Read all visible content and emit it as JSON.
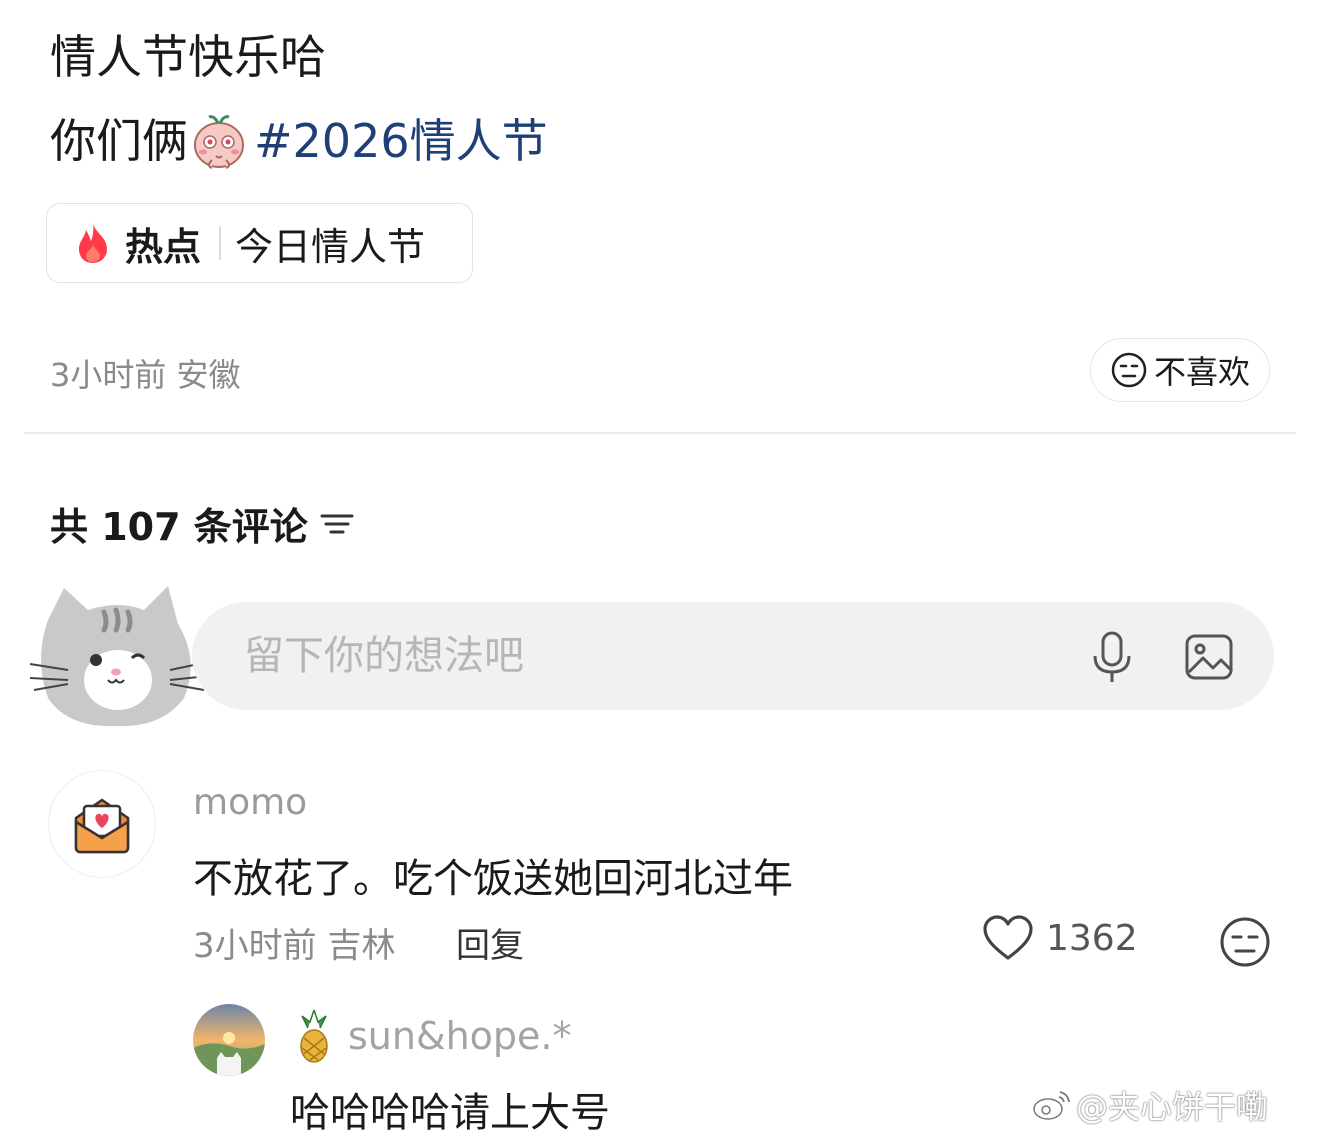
{
  "post": {
    "line1": "情人节快乐哈",
    "line2_prefix": "你们俩",
    "emoji": "shy-baby-emoji",
    "hashtag": "#2026情人节"
  },
  "hot_topic": {
    "label": "热点",
    "topic": "今日情人节",
    "icon": "fire-icon"
  },
  "post_meta": {
    "time": "3小时前",
    "location": "安徽"
  },
  "dislike_label": "不喜欢",
  "comments": {
    "title": "共 107 条评论",
    "input_placeholder": "留下你的想法吧"
  },
  "comment": {
    "user": "momo",
    "text": "不放花了。吃个饭送她回河北过年",
    "time": "3小时前",
    "location": "吉林",
    "reply_label": "回复",
    "likes": "1362"
  },
  "reply": {
    "user": "sun&hope.*",
    "badge": "pineapple-icon",
    "text": "哈哈哈哈请上大号"
  },
  "watermark": "@夹心饼干嘞",
  "colors": {
    "hashtag": "#1f3f77",
    "fire": "#ff3b4a",
    "muted": "#8a8a8a",
    "input_bg": "#f1f1f3"
  }
}
